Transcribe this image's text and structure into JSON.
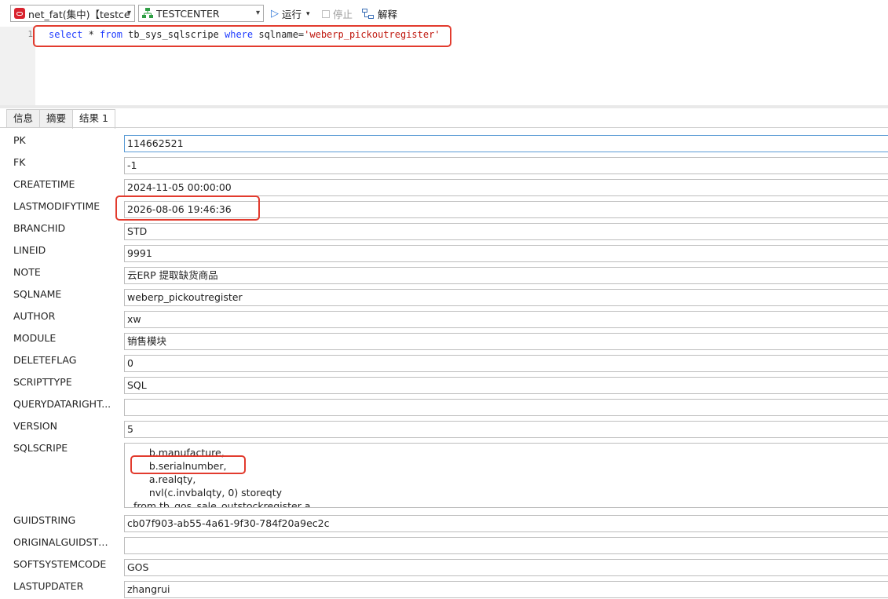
{
  "toolbar": {
    "connection": "net_fat(集中)【testce",
    "database": "TESTCENTER",
    "run_label": "运行",
    "stop_label": "停止",
    "explain_label": "解释"
  },
  "editor": {
    "line_number": "1",
    "tokens": [
      "select",
      " * ",
      "from",
      " tb_sys_sqlscripe ",
      "where",
      " sqlname=",
      "'weberp_pickoutregister'"
    ]
  },
  "tabs": [
    "信息",
    "摘要",
    "结果 1"
  ],
  "fields": [
    {
      "label": "PK",
      "value": "114662521"
    },
    {
      "label": "FK",
      "value": "-1"
    },
    {
      "label": "CREATETIME",
      "value": "2024-11-05 00:00:00"
    },
    {
      "label": "LASTMODIFYTIME",
      "value": "2026-08-06 19:46:36"
    },
    {
      "label": "BRANCHID",
      "value": "STD"
    },
    {
      "label": "LINEID",
      "value": "9991"
    },
    {
      "label": "NOTE",
      "value": "云ERP 提取缺货商品"
    },
    {
      "label": "SQLNAME",
      "value": "weberp_pickoutregister"
    },
    {
      "label": "AUTHOR",
      "value": "xw"
    },
    {
      "label": "MODULE",
      "value": "销售模块"
    },
    {
      "label": "DELETEFLAG",
      "value": "0"
    },
    {
      "label": "SCRIPTTYPE",
      "value": "SQL"
    },
    {
      "label": "QUERYDATARIGHT...",
      "value": ""
    },
    {
      "label": "VERSION",
      "value": "5"
    },
    {
      "label": "SQLSCRIPE",
      "lines": [
        "       b.manufacture,",
        "       b.serialnumber,",
        "       a.realqty,",
        "       nvl(c.invbalqty, 0) storeqty",
        "  from tb_gos_sale_outstockregister a"
      ]
    },
    {
      "label": "GUIDSTRING",
      "value": "cb07f903-ab55-4a61-9f30-784f20a9ec2c"
    },
    {
      "label": "ORIGINALGUIDSTR...",
      "value": ""
    },
    {
      "label": "SOFTSYSTEMCODE",
      "value": "GOS"
    },
    {
      "label": "LASTUPDATER",
      "value": "zhangrui"
    }
  ],
  "colors": {
    "highlight": "#e23b2e",
    "keyword": "#1f3cff",
    "string": "#c0180f"
  }
}
